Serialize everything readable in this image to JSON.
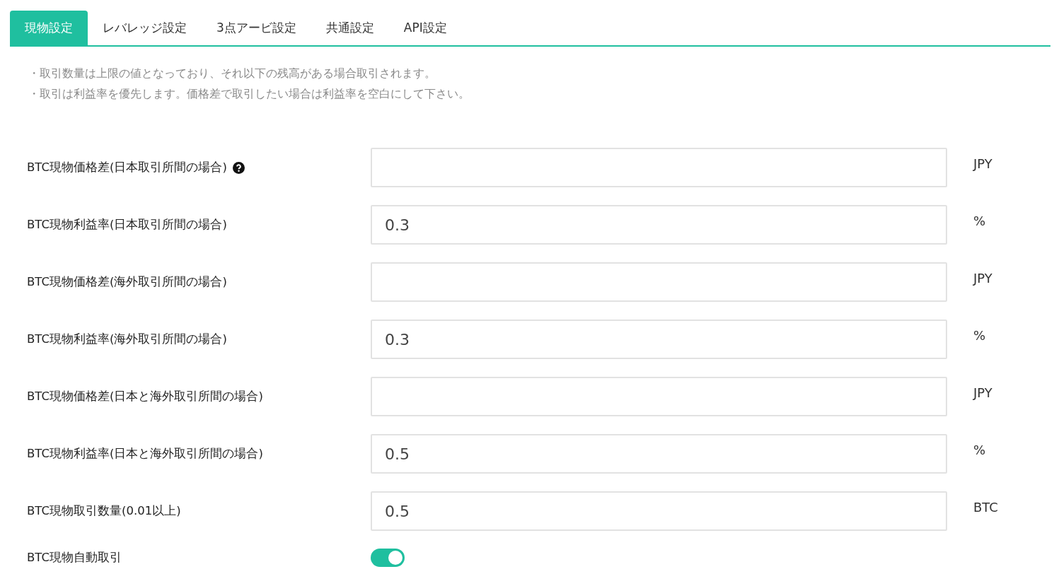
{
  "tabs": [
    {
      "label": "現物設定",
      "selected": true
    },
    {
      "label": "レバレッジ設定",
      "selected": false
    },
    {
      "label": "3点アービ設定",
      "selected": false
    },
    {
      "label": "共通設定",
      "selected": false
    },
    {
      "label": "API設定",
      "selected": false
    }
  ],
  "notes": [
    "・取引数量は上限の値となっており、それ以下の残高がある場合取引されます。",
    "・取引は利益率を優先します。価格差で取引したい場合は利益率を空白にして下さい。"
  ],
  "rows": [
    {
      "kind": "input",
      "label": "BTC現物価格差(日本取引所間の場合)",
      "help": true,
      "unit": "JPY"
    },
    {
      "kind": "input",
      "label": "BTC現物利益率(日本取引所間の場合)",
      "help": false,
      "value": "0.3",
      "unit": "%"
    },
    {
      "kind": "input",
      "label": "BTC現物価格差(海外取引所間の場合)",
      "help": false,
      "unit": "JPY"
    },
    {
      "kind": "input",
      "label": "BTC現物利益率(海外取引所間の場合)",
      "help": false,
      "value": "0.3",
      "unit": "%"
    },
    {
      "kind": "input",
      "label": "BTC現物価格差(日本と海外取引所間の場合)",
      "help": false,
      "unit": "JPY"
    },
    {
      "kind": "input",
      "label": "BTC現物利益率(日本と海外取引所間の場合)",
      "help": false,
      "value": "0.5",
      "unit": "%"
    },
    {
      "kind": "input",
      "label": "BTC現物取引数量(0.01以上)",
      "help": false,
      "value": "0.5",
      "unit": "BTC"
    },
    {
      "kind": "toggle",
      "label": "BTC現物自動取引",
      "help": false,
      "on": true
    }
  ]
}
